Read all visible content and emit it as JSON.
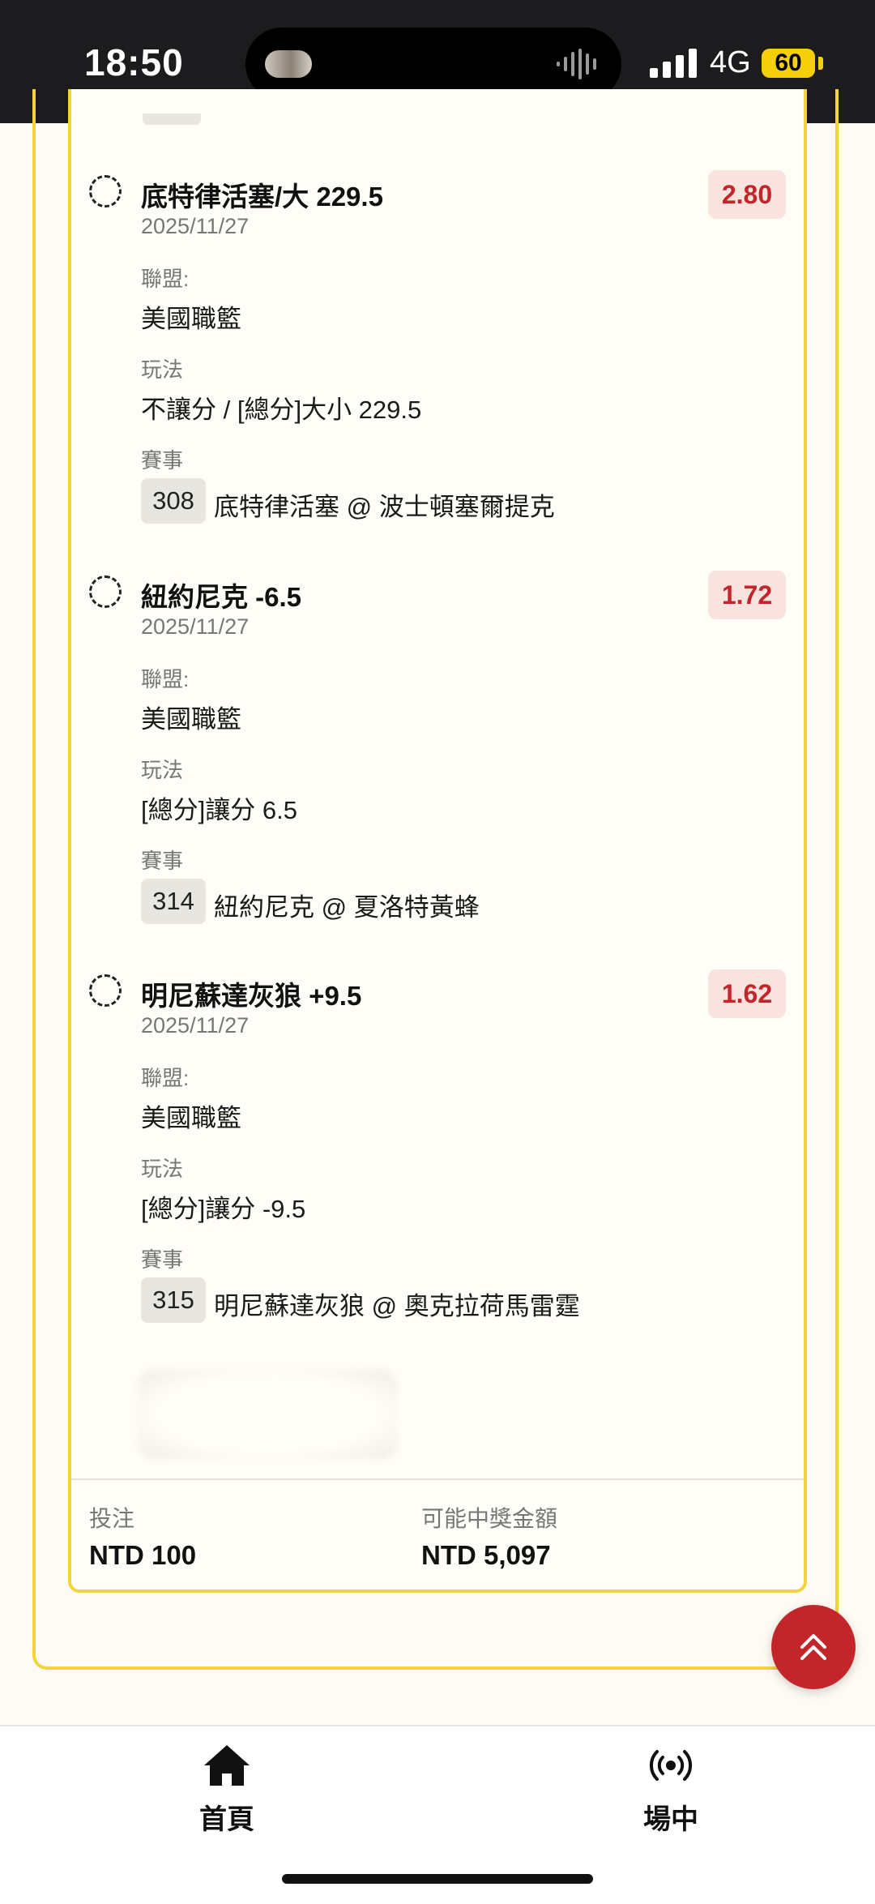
{
  "status_bar": {
    "time": "18:50",
    "network": "4G",
    "battery": "60"
  },
  "bets": [
    {
      "title": "底特律活塞/大 229.5",
      "odds": "2.80",
      "date": "2025/11/27",
      "league_label": "聯盟:",
      "league": "美國職籃",
      "play_label": "玩法",
      "play": "不讓分 / [總分]大小 229.5",
      "match_label": "賽事",
      "match_no": "308",
      "match": "底特律活塞 @ 波士頓塞爾提克"
    },
    {
      "title": "紐約尼克 -6.5",
      "odds": "1.72",
      "date": "2025/11/27",
      "league_label": "聯盟:",
      "league": "美國職籃",
      "play_label": "玩法",
      "play": "[總分]讓分 6.5",
      "match_label": "賽事",
      "match_no": "314",
      "match": "紐約尼克 @ 夏洛特黃蜂"
    },
    {
      "title": "明尼蘇達灰狼 +9.5",
      "odds": "1.62",
      "date": "2025/11/27",
      "league_label": "聯盟:",
      "league": "美國職籃",
      "play_label": "玩法",
      "play": "[總分]讓分 -9.5",
      "match_label": "賽事",
      "match_no": "315",
      "match": "明尼蘇達灰狼 @ 奧克拉荷馬雷霆"
    }
  ],
  "summary": {
    "stake_label": "投注",
    "stake_value": "NTD 100",
    "payout_label": "可能中獎金額",
    "payout_value": "NTD 5,097"
  },
  "tabs": [
    {
      "label": "首頁",
      "icon": "home-icon"
    },
    {
      "label": "場中",
      "icon": "live-broadcast-icon"
    }
  ],
  "colors": {
    "accent_yellow": "#f2d43a",
    "odds_red": "#c3262a",
    "odds_bg": "#f8e3de"
  }
}
